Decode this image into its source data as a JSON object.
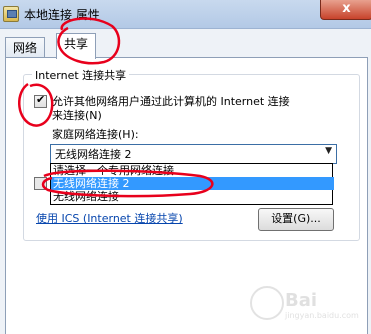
{
  "window": {
    "title": "本地连接 属性",
    "close_label": "x"
  },
  "tabs": [
    {
      "label": "网络",
      "active": false
    },
    {
      "label": "共享",
      "active": true
    }
  ],
  "sharing": {
    "group_title": "Internet 连接共享",
    "allow_checkbox": {
      "checked": true,
      "label_line1": "允许其他网络用户通过此计算机的 Internet 连接",
      "label_line2": "来连接(N)"
    },
    "home_network_label": "家庭网络连接(H):",
    "home_network_select": {
      "value": "无线网络连接 2",
      "options": [
        "请选择一个专用网络连接",
        "无线网络连接 2",
        "无线网络连接"
      ],
      "highlighted_index": 1
    },
    "ics_link": "使用 ICS (Internet 连接共享)",
    "settings_button": "设置(G)..."
  },
  "watermark": {
    "text": "Bai",
    "sub": "jingyan.baidu.com"
  },
  "colors": {
    "annotation": "#e8001c",
    "selection": "#3399ff",
    "titlebar": "#b3c9e6"
  }
}
